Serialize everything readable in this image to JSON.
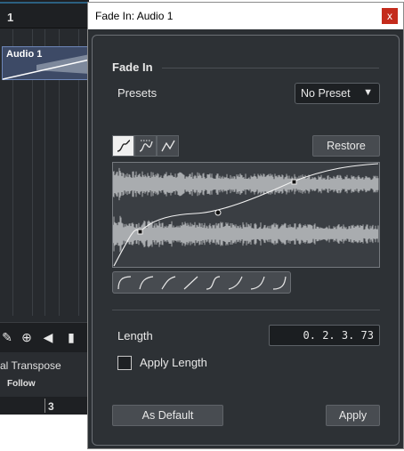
{
  "background": {
    "ruler_bar": "1",
    "event_name": "Audio 1",
    "toolbar_icons": [
      "pencil-icon",
      "zoom-icon",
      "mute-icon",
      "speaker-icon"
    ],
    "transpose_label": "al Transpose",
    "follow_label": "Follow",
    "lower_ruler_bar": "3"
  },
  "dialog": {
    "title": "Fade In: Audio 1",
    "close_glyph": "x",
    "section_title": "Fade In",
    "presets_label": "Presets",
    "presets_value": "No Preset",
    "curve_types": [
      "spline-curve",
      "damped-spline-curve",
      "linear-curve"
    ],
    "restore_label": "Restore",
    "preset_shapes": [
      "convex-fast",
      "convex",
      "convex-slow",
      "linear",
      "s-curve",
      "concave-slow",
      "concave",
      "concave-fast"
    ],
    "length_label": "Length",
    "length_value": "0. 2. 3. 73",
    "apply_length_label": "Apply Length",
    "apply_length_checked": false,
    "as_default_label": "As Default",
    "apply_label": "Apply"
  },
  "colors": {
    "dialog_bg": "#2b2f33",
    "close_button": "#c42b1c",
    "waveform": "#a9acaf",
    "curve": "#f2f2f2"
  }
}
